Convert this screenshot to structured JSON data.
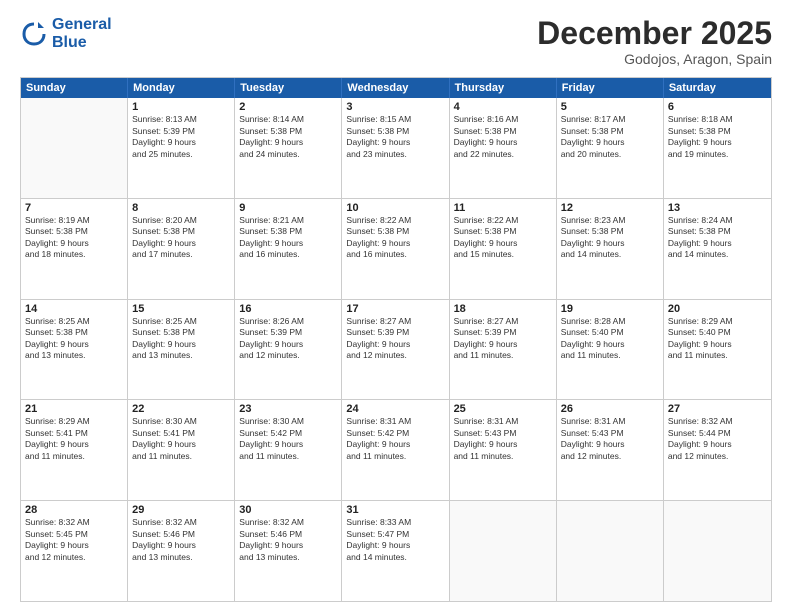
{
  "logo": {
    "line1": "General",
    "line2": "Blue"
  },
  "title": "December 2025",
  "subtitle": "Godojos, Aragon, Spain",
  "days": [
    "Sunday",
    "Monday",
    "Tuesday",
    "Wednesday",
    "Thursday",
    "Friday",
    "Saturday"
  ],
  "weeks": [
    [
      {
        "date": "",
        "info": ""
      },
      {
        "date": "1",
        "info": "Sunrise: 8:13 AM\nSunset: 5:39 PM\nDaylight: 9 hours\nand 25 minutes."
      },
      {
        "date": "2",
        "info": "Sunrise: 8:14 AM\nSunset: 5:38 PM\nDaylight: 9 hours\nand 24 minutes."
      },
      {
        "date": "3",
        "info": "Sunrise: 8:15 AM\nSunset: 5:38 PM\nDaylight: 9 hours\nand 23 minutes."
      },
      {
        "date": "4",
        "info": "Sunrise: 8:16 AM\nSunset: 5:38 PM\nDaylight: 9 hours\nand 22 minutes."
      },
      {
        "date": "5",
        "info": "Sunrise: 8:17 AM\nSunset: 5:38 PM\nDaylight: 9 hours\nand 20 minutes."
      },
      {
        "date": "6",
        "info": "Sunrise: 8:18 AM\nSunset: 5:38 PM\nDaylight: 9 hours\nand 19 minutes."
      }
    ],
    [
      {
        "date": "7",
        "info": "Sunrise: 8:19 AM\nSunset: 5:38 PM\nDaylight: 9 hours\nand 18 minutes."
      },
      {
        "date": "8",
        "info": "Sunrise: 8:20 AM\nSunset: 5:38 PM\nDaylight: 9 hours\nand 17 minutes."
      },
      {
        "date": "9",
        "info": "Sunrise: 8:21 AM\nSunset: 5:38 PM\nDaylight: 9 hours\nand 16 minutes."
      },
      {
        "date": "10",
        "info": "Sunrise: 8:22 AM\nSunset: 5:38 PM\nDaylight: 9 hours\nand 16 minutes."
      },
      {
        "date": "11",
        "info": "Sunrise: 8:22 AM\nSunset: 5:38 PM\nDaylight: 9 hours\nand 15 minutes."
      },
      {
        "date": "12",
        "info": "Sunrise: 8:23 AM\nSunset: 5:38 PM\nDaylight: 9 hours\nand 14 minutes."
      },
      {
        "date": "13",
        "info": "Sunrise: 8:24 AM\nSunset: 5:38 PM\nDaylight: 9 hours\nand 14 minutes."
      }
    ],
    [
      {
        "date": "14",
        "info": "Sunrise: 8:25 AM\nSunset: 5:38 PM\nDaylight: 9 hours\nand 13 minutes."
      },
      {
        "date": "15",
        "info": "Sunrise: 8:25 AM\nSunset: 5:38 PM\nDaylight: 9 hours\nand 13 minutes."
      },
      {
        "date": "16",
        "info": "Sunrise: 8:26 AM\nSunset: 5:39 PM\nDaylight: 9 hours\nand 12 minutes."
      },
      {
        "date": "17",
        "info": "Sunrise: 8:27 AM\nSunset: 5:39 PM\nDaylight: 9 hours\nand 12 minutes."
      },
      {
        "date": "18",
        "info": "Sunrise: 8:27 AM\nSunset: 5:39 PM\nDaylight: 9 hours\nand 11 minutes."
      },
      {
        "date": "19",
        "info": "Sunrise: 8:28 AM\nSunset: 5:40 PM\nDaylight: 9 hours\nand 11 minutes."
      },
      {
        "date": "20",
        "info": "Sunrise: 8:29 AM\nSunset: 5:40 PM\nDaylight: 9 hours\nand 11 minutes."
      }
    ],
    [
      {
        "date": "21",
        "info": "Sunrise: 8:29 AM\nSunset: 5:41 PM\nDaylight: 9 hours\nand 11 minutes."
      },
      {
        "date": "22",
        "info": "Sunrise: 8:30 AM\nSunset: 5:41 PM\nDaylight: 9 hours\nand 11 minutes."
      },
      {
        "date": "23",
        "info": "Sunrise: 8:30 AM\nSunset: 5:42 PM\nDaylight: 9 hours\nand 11 minutes."
      },
      {
        "date": "24",
        "info": "Sunrise: 8:31 AM\nSunset: 5:42 PM\nDaylight: 9 hours\nand 11 minutes."
      },
      {
        "date": "25",
        "info": "Sunrise: 8:31 AM\nSunset: 5:43 PM\nDaylight: 9 hours\nand 11 minutes."
      },
      {
        "date": "26",
        "info": "Sunrise: 8:31 AM\nSunset: 5:43 PM\nDaylight: 9 hours\nand 12 minutes."
      },
      {
        "date": "27",
        "info": "Sunrise: 8:32 AM\nSunset: 5:44 PM\nDaylight: 9 hours\nand 12 minutes."
      }
    ],
    [
      {
        "date": "28",
        "info": "Sunrise: 8:32 AM\nSunset: 5:45 PM\nDaylight: 9 hours\nand 12 minutes."
      },
      {
        "date": "29",
        "info": "Sunrise: 8:32 AM\nSunset: 5:46 PM\nDaylight: 9 hours\nand 13 minutes."
      },
      {
        "date": "30",
        "info": "Sunrise: 8:32 AM\nSunset: 5:46 PM\nDaylight: 9 hours\nand 13 minutes."
      },
      {
        "date": "31",
        "info": "Sunrise: 8:33 AM\nSunset: 5:47 PM\nDaylight: 9 hours\nand 14 minutes."
      },
      {
        "date": "",
        "info": ""
      },
      {
        "date": "",
        "info": ""
      },
      {
        "date": "",
        "info": ""
      }
    ]
  ]
}
